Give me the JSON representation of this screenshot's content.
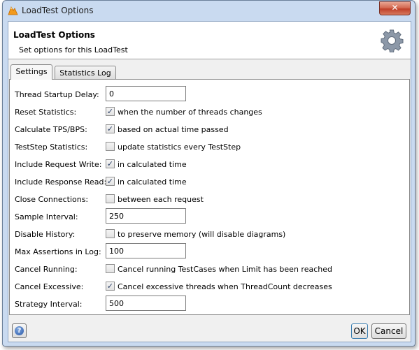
{
  "window": {
    "title": "LoadTest Options",
    "close_label": "✕"
  },
  "header": {
    "title": "LoadTest Options",
    "subtitle": "Set options for this LoadTest",
    "icon": "gear-icon"
  },
  "tabs": [
    {
      "label": "Settings",
      "selected": true
    },
    {
      "label": "Statistics Log",
      "selected": false
    }
  ],
  "fields": {
    "thread_startup_delay": {
      "label": "Thread Startup Delay:",
      "value": "0"
    },
    "reset_statistics": {
      "label": "Reset Statistics:",
      "checked": true,
      "text": "when the number of threads changes"
    },
    "calculate_tps": {
      "label": "Calculate TPS/BPS:",
      "checked": true,
      "text": "based on actual time passed"
    },
    "teststep_statistics": {
      "label": "TestStep Statistics:",
      "checked": false,
      "text": "update statistics every TestStep"
    },
    "include_request_write": {
      "label": "Include Request Write:",
      "checked": true,
      "text": "in calculated time"
    },
    "include_response_read": {
      "label": "Include Response Read:",
      "checked": true,
      "text": "in calculated time"
    },
    "close_connections": {
      "label": "Close Connections:",
      "checked": false,
      "text": "between each request"
    },
    "sample_interval": {
      "label": "Sample Interval:",
      "value": "250"
    },
    "disable_history": {
      "label": "Disable History:",
      "checked": false,
      "text": "to preserve memory (will disable diagrams)"
    },
    "max_assertions": {
      "label": "Max Assertions in Log:",
      "value": "100"
    },
    "cancel_running": {
      "label": "Cancel Running:",
      "checked": false,
      "text": "Cancel running TestCases when Limit has been reached"
    },
    "cancel_excessive": {
      "label": "Cancel Excessive:",
      "checked": true,
      "text": "Cancel excessive threads when ThreadCount decreases"
    },
    "strategy_interval": {
      "label": "Strategy Interval:",
      "value": "500"
    }
  },
  "footer": {
    "help_label": "?",
    "ok_label": "OK",
    "cancel_label": "Cancel"
  },
  "colors": {
    "title_bar": "#c9daf0",
    "close_button": "#c0412a",
    "checkmark": "#2a3f66"
  }
}
